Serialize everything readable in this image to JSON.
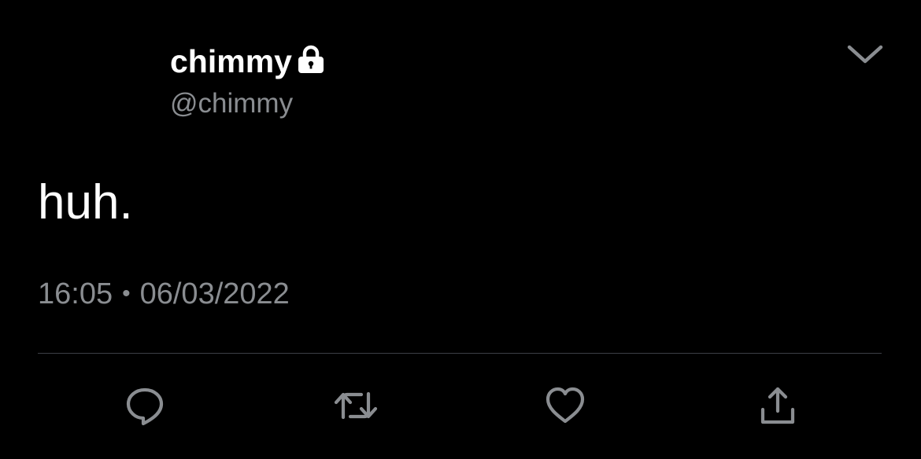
{
  "tweet": {
    "display_name": "chimmy",
    "handle": "@chimmy",
    "protected": true,
    "text": "huh.",
    "time": "16:05",
    "separator": "•",
    "date": "06/03/2022"
  },
  "icons": {
    "lock": "lock-icon",
    "menu": "chevron-down-icon",
    "reply": "reply-icon",
    "retweet": "retweet-icon",
    "like": "heart-icon",
    "share": "share-icon"
  },
  "colors": {
    "background": "#000000",
    "primary_text": "#ffffff",
    "secondary_text": "#8a8d91",
    "divider": "#3d4046",
    "icon": "#8a8d91"
  }
}
